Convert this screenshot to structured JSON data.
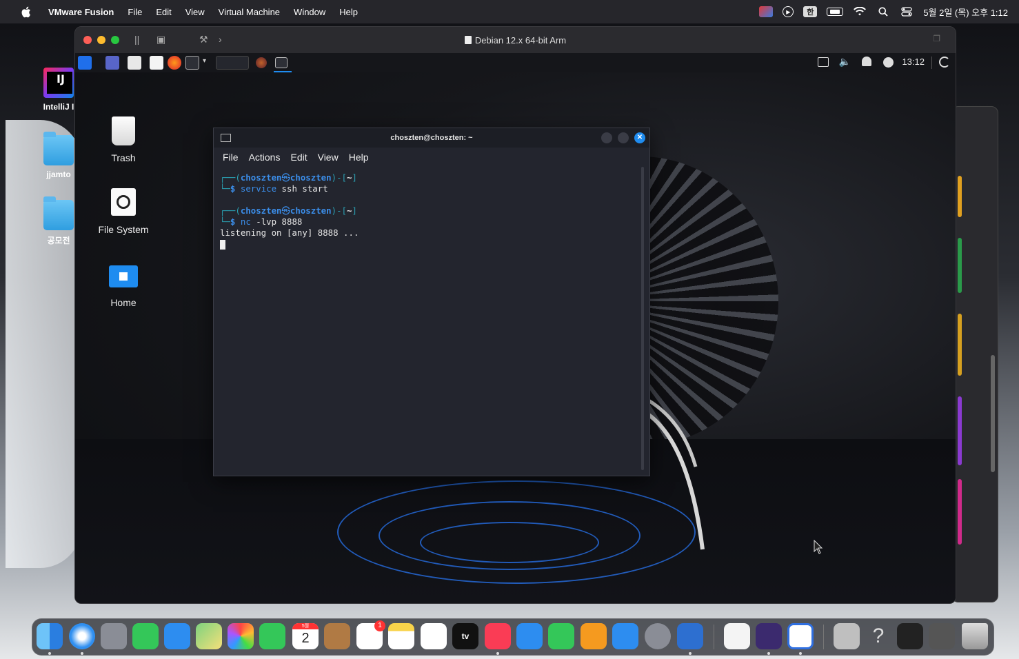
{
  "menubar": {
    "app_name": "VMware Fusion",
    "items": [
      "File",
      "Edit",
      "View",
      "Virtual Machine",
      "Window",
      "Help"
    ],
    "status": {
      "input_method": "한",
      "datetime": "5월 2일 (목) 오후 1:12"
    }
  },
  "desktop": {
    "icons": [
      {
        "label": "IntelliJ I"
      },
      {
        "label": "jjamto"
      },
      {
        "label": "공모전"
      }
    ]
  },
  "vm_window": {
    "title": "Debian 12.x 64-bit Arm"
  },
  "guest": {
    "panel": {
      "clock": "13:12"
    },
    "desktop_icons": [
      {
        "label": "Trash"
      },
      {
        "label": "File System"
      },
      {
        "label": "Home"
      }
    ],
    "terminal": {
      "title": "choszten@choszten: ~",
      "menu": [
        "File",
        "Actions",
        "Edit",
        "View",
        "Help"
      ],
      "prompt_user": "choszten",
      "prompt_symbol": "㉿",
      "prompt_host": "choszten",
      "prompt_dir": "~",
      "commands": [
        {
          "cmd": "service",
          "args": " ssh start"
        },
        {
          "cmd": "nc",
          "args": " -lvp 8888"
        }
      ],
      "output": "listening on [any] 8888 ..."
    }
  },
  "dock": {
    "calendar_month": "5월",
    "calendar_day": "2",
    "reminders_badge": "1",
    "tv_label": "tv"
  }
}
